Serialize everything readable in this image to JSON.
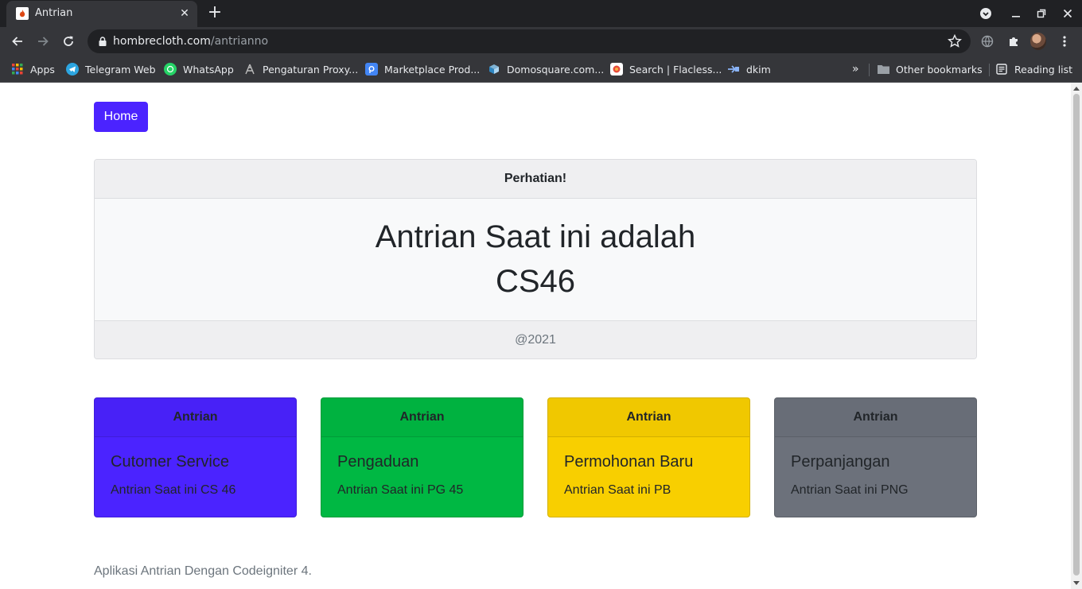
{
  "browser": {
    "tab_title": "Antrian",
    "tab_close": "✕",
    "new_tab": "+",
    "url_host": "hombrecloth.com",
    "url_path": "/antrianno",
    "bookmarks": [
      {
        "label": "Apps",
        "icon": "apps-grid-icon",
        "color": "#ea4335"
      },
      {
        "label": "Telegram Web",
        "icon": "telegram-icon",
        "color": "#2ca5e0"
      },
      {
        "label": "WhatsApp",
        "icon": "whatsapp-icon",
        "color": "#25d366"
      },
      {
        "label": "Pengaturan Proxy...",
        "icon": "proxy-icon",
        "color": "#bdbdbd"
      },
      {
        "label": "Marketplace Prod...",
        "icon": "marketplace-icon",
        "color": "#4285f4"
      },
      {
        "label": "Domosquare.com...",
        "icon": "domosquare-icon",
        "color": "#7fb3d5"
      },
      {
        "label": "Search | Flacless...",
        "icon": "flacless-icon",
        "color": "#e74c3c"
      },
      {
        "label": "dkim",
        "icon": "dkim-icon",
        "color": "#8ab4f8"
      }
    ],
    "more_bookmarks": "»",
    "other_bookmarks": "Other bookmarks",
    "reading_list": "Reading list"
  },
  "page": {
    "home_label": "Home",
    "notice": {
      "header": "Perhatian!",
      "line1": "Antrian Saat ini adalah",
      "line2": "CS46",
      "footer": "@2021"
    },
    "cards": [
      {
        "header": "Antrian",
        "title": "Cutomer Service",
        "text": "Antrian Saat ini CS 46",
        "color": "#4b23ff"
      },
      {
        "header": "Antrian",
        "title": "Pengaduan",
        "text": "Antrian Saat ini PG 45",
        "color": "#00b843"
      },
      {
        "header": "Antrian",
        "title": "Permohonan Baru",
        "text": "Antrian Saat ini PB",
        "color": "#f8cf00"
      },
      {
        "header": "Antrian",
        "title": "Perpanjangan",
        "text": "Antrian Saat ini PNG",
        "color": "#6c717b"
      }
    ],
    "footer_text": "Aplikasi Antrian Dengan Codeigniter 4."
  }
}
